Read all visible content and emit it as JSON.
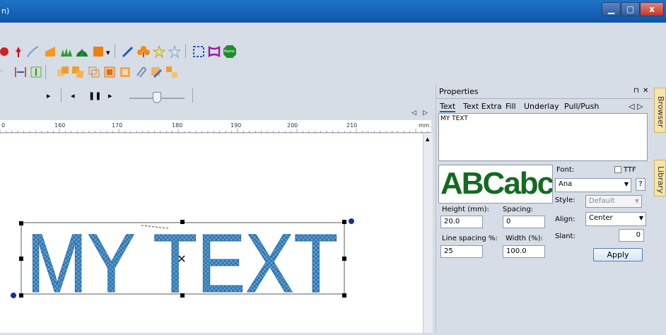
{
  "window": {
    "title_fragment": "n)"
  },
  "controls": {
    "min": "▁",
    "max": "▢",
    "close": "x"
  },
  "icons": [
    "red-bloom-icon",
    "red-tulip-icon",
    "blue-stroke-icon",
    "orange-corner-icon",
    "green-grass-icon",
    "green-fan-icon",
    "orange-square-icon",
    "blue-needle-icon",
    "orange-club-icon",
    "star-wand-icon",
    "wand-icon",
    "select-frame-icon",
    "hoop-icon",
    "name-icon"
  ],
  "name_badge": "Name",
  "ruler": {
    "unit": "mm",
    "labels": [
      "0",
      "160",
      "170",
      "180",
      "190",
      "200",
      "210"
    ]
  },
  "canvas_text": "MY TEXT",
  "properties": {
    "title": "Properties",
    "pin": "⊓",
    "close": "✕",
    "tabs": [
      "Text",
      "Text Extra",
      "Fill",
      "Underlay",
      "Pull/Push"
    ],
    "tab_arrows": "◁ ▷",
    "text_value": "MY TEXT",
    "preview_text": "ABCabc",
    "font_label": "Font:",
    "ttf_label": "TTF",
    "font_value": "Ana",
    "help": "?",
    "style_label": "Style:",
    "style_value": "Default",
    "height_label": "Height (mm):",
    "height_value": "20.0",
    "spacing_label": "Spacing:",
    "spacing_value": "0",
    "align_label": "Align:",
    "align_value": "Center",
    "line_spacing_label": "Line spacing %:",
    "line_spacing_value": "25",
    "width_label": "Width (%):",
    "width_value": "100.0",
    "slant_label": "Slant:",
    "slant_value": "0",
    "apply_label": "Apply"
  },
  "side_tabs": {
    "browser": "Browser",
    "library": "Library"
  }
}
